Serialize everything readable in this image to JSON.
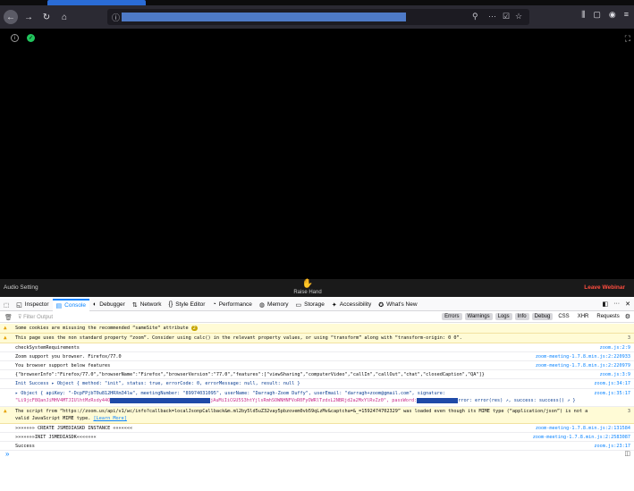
{
  "browser": {
    "nav": {
      "back": "←",
      "forward": "→",
      "reload": "↻",
      "home": "⌂"
    },
    "url": "",
    "url_icons": [
      "ⓘ",
      "⚲",
      "···",
      "☑",
      "☆"
    ],
    "toolbar_icons": [
      "⫼",
      "▢",
      "◉",
      "≡"
    ]
  },
  "meeting": {
    "audio_label": "Audio Setting",
    "raise_label": "Raise Hand",
    "raise_icon": "✋",
    "leave_label": "Leave Webinar",
    "fullscreen_icon": "⛶"
  },
  "devtools": {
    "tabs": [
      {
        "icon": "◱",
        "label": "Inspector"
      },
      {
        "icon": "▤",
        "label": "Console"
      },
      {
        "icon": "◐",
        "label": "Debugger"
      },
      {
        "icon": "⇅",
        "label": "Network"
      },
      {
        "icon": "{}",
        "label": "Style Editor"
      },
      {
        "icon": "◔",
        "label": "Performance"
      },
      {
        "icon": "◍",
        "label": "Memory"
      },
      {
        "icon": "▭",
        "label": "Storage"
      },
      {
        "icon": "✦",
        "label": "Accessibility"
      },
      {
        "icon": "✪",
        "label": "What's New"
      }
    ],
    "filter_placeholder": "Filter Output",
    "filters": [
      "Errors",
      "Warnings",
      "Logs",
      "Info",
      "Debug",
      "CSS",
      "XHR",
      "Requests"
    ],
    "logs": [
      {
        "type": "warn",
        "text": "Some cookies are misusing the recommended “sameSite“ attribute",
        "count": "2",
        "src": ""
      },
      {
        "type": "warn",
        "text": "This page uses the non standard property “zoom”. Consider using calc() in the relevant property values, or using “transform” along with “transform-origin: 0 0”.",
        "src": "3"
      },
      {
        "type": "log",
        "text": "checkSystemRequirements",
        "src": "zoom.js:2:9"
      },
      {
        "type": "log",
        "text": "Zoom support you browser. Firefox/77.0",
        "src": "zoom-meeting-1.7.8.min.js:2:220933"
      },
      {
        "type": "log",
        "text": "You browser support below features",
        "src": "zoom-meeting-1.7.8.min.js:2:220979"
      },
      {
        "type": "log",
        "text": "{\"browserInfo\":\"Firefox/77.0\",\"browserName\":\"Firefox\",\"browserVersion\":\"77.0\",\"features\":[\"viewSharing\",\"computerVideo\",\"callIn\",\"callOut\",\"chat\",\"closedCaption\",\"QA\"]}",
        "src": "zoom.js:3:9"
      },
      {
        "type": "log",
        "text": "Init Success  ▸ Object { method: \"init\", status: true, errorCode: 0, errorMessage: null, result: null }",
        "src": "zoom.js:34:17"
      },
      {
        "type": "log",
        "text": "▸ Object { apiKey: \"-DcpFPjbT0u812HRXm34lw\", meetingNumber: \"89974031095\", userName: \"Darragh-Zoom Duffy\", userEmail: \"darragh+zoom@gmail.com\", signature:",
        "text2": "\"Li9jcF8QanJiMHV4MTJIUlhtMzRsdy44O",
        "text3": "jAuMiIiCGU5S3htYjlsRmhSOWNHNFVoR0FyOWRlTzdxL2NBRjd2a2MxYlRvZz0\", passWord:",
        "text4": "rror: error(res) ↗︎, success: success() ↗︎ }",
        "src": "zoom.js:35:17"
      },
      {
        "type": "warn",
        "text": "The script from “https://zoom.us/api/v1/wc/info?callback=localJsonpCallback&m.ml2by5ld5uZ32vay5pbzovem0vb59qLzMv&captcha=&_=1592474702329” was loaded even though its MIME type (“application/json”) is not a",
        "text2": "valid JavaScript MIME type.",
        "link": "[Learn More]",
        "src": "3"
      },
      {
        "type": "log",
        "text": "»»»»»»» CREATE JSMEDIASKD INSTANCE «««««««",
        "src": "zoom-meeting-1.7.8.min.js:2:131584"
      },
      {
        "type": "log",
        "text": "»»»»»»»INIT JSMEDIASDK«««««««",
        "src": "zoom-meeting-1.7.8.min.js:2:2583087"
      },
      {
        "type": "log",
        "text": "Success",
        "src": "zoom.js:23:17"
      }
    ],
    "prompt": "»"
  }
}
